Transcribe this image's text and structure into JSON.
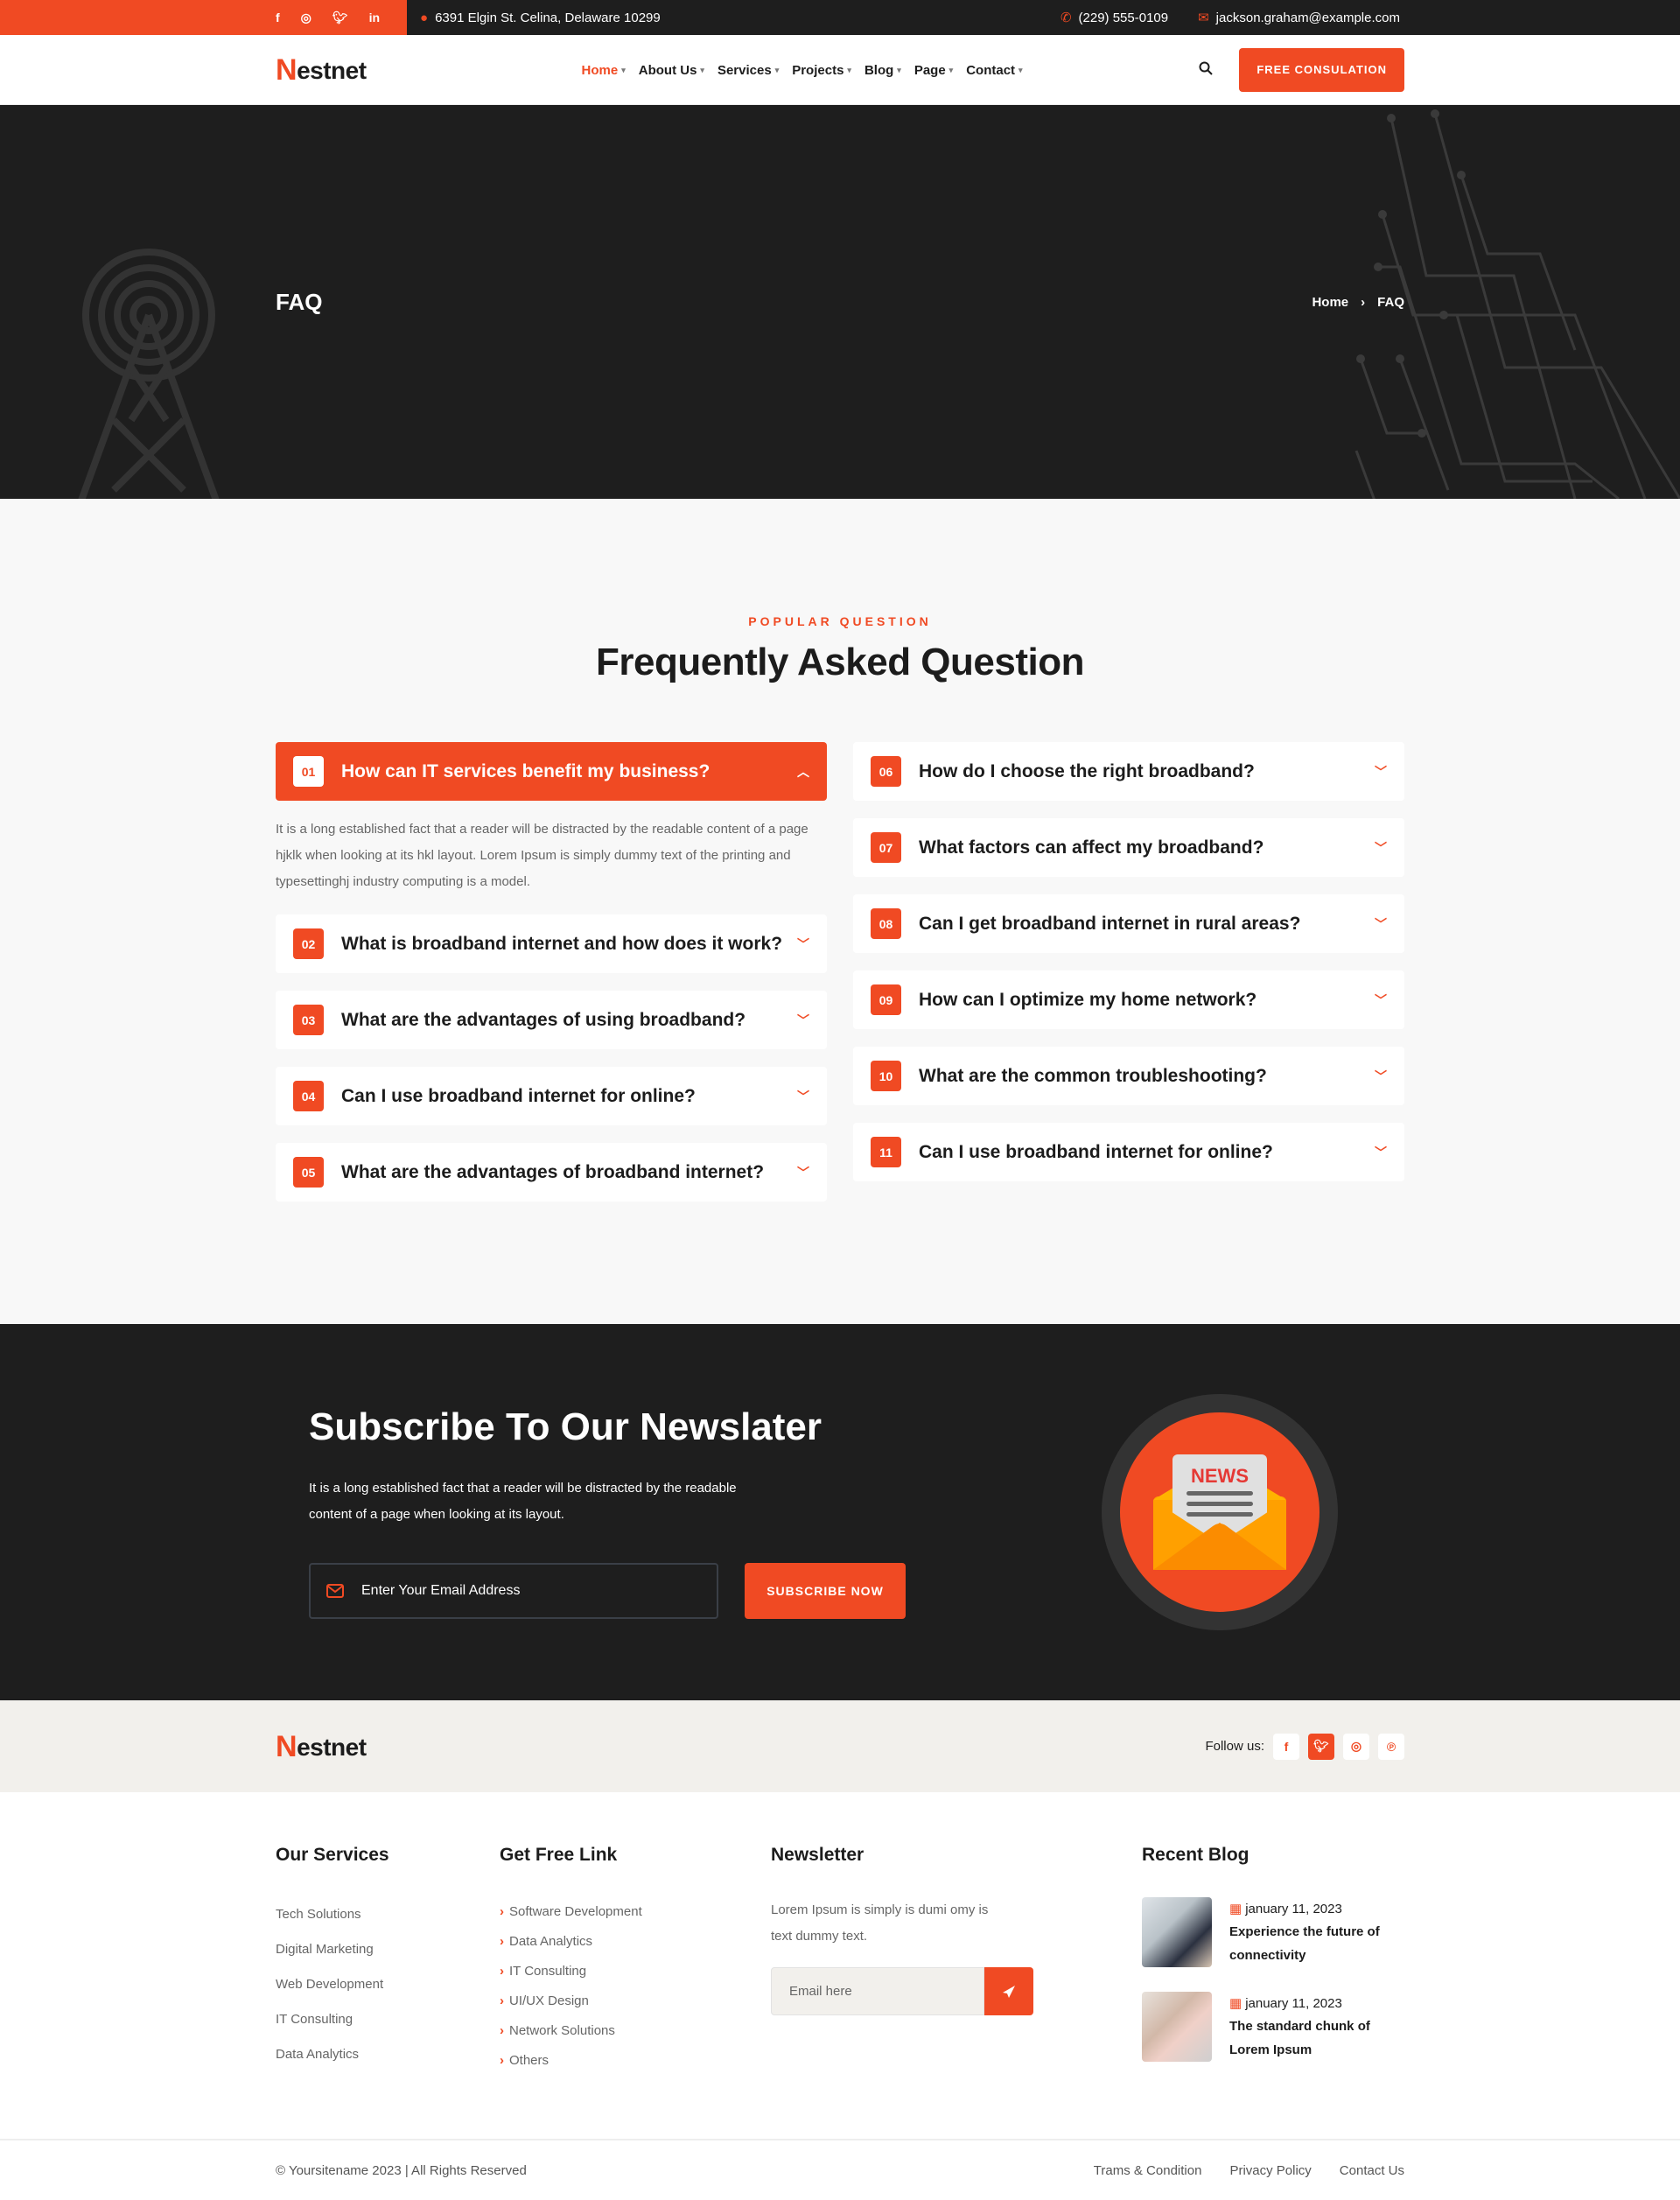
{
  "topbar": {
    "social": [
      "facebook",
      "instagram",
      "twitter",
      "linkedin"
    ],
    "address": "6391 Elgin St. Celina, Delaware 10299",
    "phone": "(229) 555-0109",
    "email": "jackson.graham@example.com"
  },
  "brand": {
    "logo_initial": "N",
    "logo_rest": "estnet"
  },
  "nav": {
    "items": [
      {
        "label": "Home",
        "active": true
      },
      {
        "label": "About Us"
      },
      {
        "label": "Services"
      },
      {
        "label": "Projects"
      },
      {
        "label": "Blog"
      },
      {
        "label": "Page"
      },
      {
        "label": "Contact"
      }
    ],
    "cta": "FREE CONSULATION"
  },
  "hero": {
    "title": "FAQ",
    "breadcrumb": [
      "Home",
      "FAQ"
    ]
  },
  "faq": {
    "eyebrow": "POPULAR QUESTION",
    "title": "Frequently Asked Question",
    "left": [
      {
        "num": "01",
        "q": "How can IT services benefit my business?",
        "open": true,
        "answer": "It is a long established fact that a reader will be distracted by the readable content of a page hjklk when looking at its hkl layout. Lorem Ipsum is simply dummy text of the printing and typesettinghj industry computing is a model."
      },
      {
        "num": "02",
        "q": "What is broadband internet and how does it work?"
      },
      {
        "num": "03",
        "q": "What are the advantages of using broadband?"
      },
      {
        "num": "04",
        "q": "Can I use broadband internet for online?"
      },
      {
        "num": "05",
        "q": "What are the advantages of broadband internet?"
      }
    ],
    "right": [
      {
        "num": "06",
        "q": "How do I choose the right broadband?"
      },
      {
        "num": "07",
        "q": "What factors can affect my broadband?"
      },
      {
        "num": "08",
        "q": "Can I get broadband internet in rural areas?"
      },
      {
        "num": "09",
        "q": "How can I optimize my home network?"
      },
      {
        "num": "10",
        "q": "What are the common troubleshooting?"
      },
      {
        "num": "11",
        "q": "Can I use broadband internet for online?"
      }
    ]
  },
  "newsletter": {
    "title": "Subscribe To Our Newslater",
    "text_line1": "It is a long established fact that a reader will be distracted by the readable",
    "text_line2": "content of a page when looking at its layout.",
    "placeholder": "Enter Your Email Address",
    "button": "SUBSCRIBE NOW",
    "badge_text": "NEWS"
  },
  "footer": {
    "follow_label": "Follow us:",
    "follow_social": [
      "facebook",
      "twitter",
      "instagram",
      "pinterest"
    ],
    "services": {
      "title": "Our Services",
      "items": [
        "Tech Solutions",
        "Digital Marketing",
        "Web Development",
        "IT Consulting",
        "Data Analytics"
      ]
    },
    "links": {
      "title": "Get Free Link",
      "items": [
        "Software Development",
        "Data Analytics",
        "IT Consulting",
        "UI/UX Design",
        "Network Solutions",
        "Others"
      ]
    },
    "newsletter": {
      "title": "Newsletter",
      "line1": "Lorem Ipsum is simply is dumi omy is",
      "line2": "text  dummy text.",
      "placeholder": "Email here"
    },
    "blog": {
      "title": "Recent Blog",
      "posts": [
        {
          "date": "january 11, 2023",
          "title_line1": "Experience the future of",
          "title_line2": "connectivity"
        },
        {
          "date": "january 11, 2023",
          "title_line1": "The standard chunk of",
          "title_line2": "Lorem Ipsum"
        }
      ]
    },
    "copyright": "© Yoursitename  2023 | All Rights Reserved",
    "bottom_links": [
      "Trams & Condition",
      "Privacy Policy",
      "Contact Us"
    ]
  },
  "colors": {
    "accent": "#f04a23",
    "dark": "#1e1e1e",
    "light_bg": "#f8f8f8",
    "beige": "#f2f0ec"
  }
}
